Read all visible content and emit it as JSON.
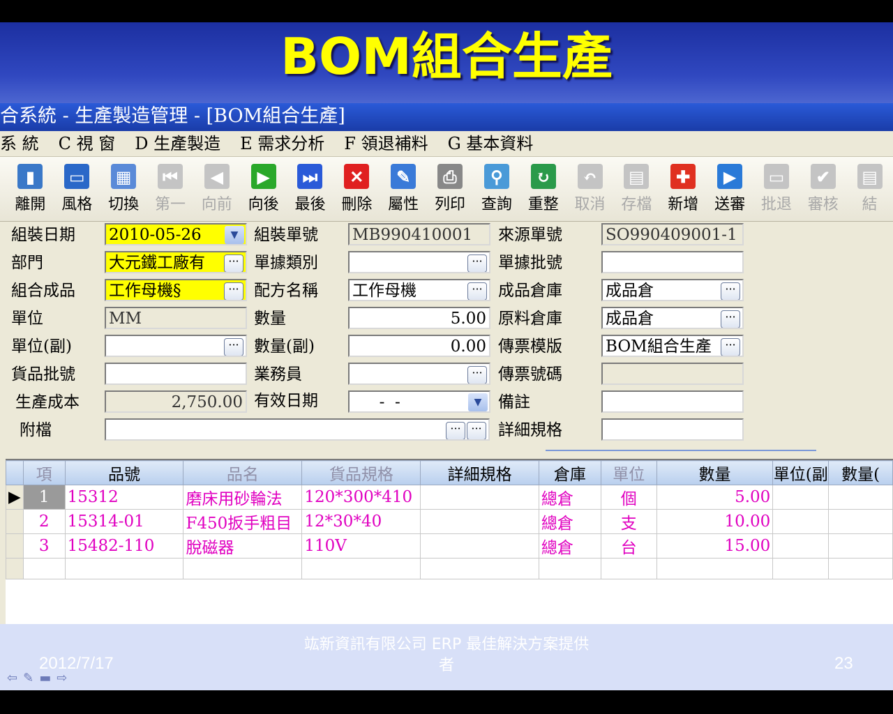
{
  "slide": {
    "title": "BOM組合生產",
    "date": "2012/7/17",
    "company": "竑新資訊有限公司  ERP 最佳解決方案提供者",
    "page": "23"
  },
  "window": {
    "title": "合系統 - 生產製造管理 - [BOM組合生產]"
  },
  "menu": [
    "系 統",
    "C 視 窗",
    "D 生產製造",
    "E 需求分析",
    "F 領退補料",
    "G 基本資料"
  ],
  "toolbar": [
    {
      "label": "離開",
      "icon": "exit-door-icon",
      "color": "#3a78c8",
      "glyph": "▮",
      "enabled": true
    },
    {
      "label": "風格",
      "icon": "window-style-icon",
      "color": "#2a68c8",
      "glyph": "▭",
      "enabled": true
    },
    {
      "label": "切換",
      "icon": "grid-switch-icon",
      "color": "#5a8ad8",
      "glyph": "▦",
      "enabled": true
    },
    {
      "label": "第一",
      "icon": "first-record-icon",
      "color": "#888",
      "glyph": "⏮",
      "enabled": false
    },
    {
      "label": "向前",
      "icon": "previous-record-icon",
      "color": "#888",
      "glyph": "◀",
      "enabled": false
    },
    {
      "label": "向後",
      "icon": "next-record-icon",
      "color": "#2aa82a",
      "glyph": "▶",
      "enabled": true
    },
    {
      "label": "最後",
      "icon": "last-record-icon",
      "color": "#2a5ad8",
      "glyph": "⏭",
      "enabled": true
    },
    {
      "label": "刪除",
      "icon": "delete-x-icon",
      "color": "#e02020",
      "glyph": "✕",
      "enabled": true
    },
    {
      "label": "屬性",
      "icon": "properties-icon",
      "color": "#3a7ad8",
      "glyph": "✎",
      "enabled": true
    },
    {
      "label": "列印",
      "icon": "printer-icon",
      "color": "#888888",
      "glyph": "⎙",
      "enabled": true
    },
    {
      "label": "查詢",
      "icon": "search-magnifier-icon",
      "color": "#4a9ad8",
      "glyph": "⚲",
      "enabled": true
    },
    {
      "label": "重整",
      "icon": "refresh-icon",
      "color": "#2a9a4a",
      "glyph": "↻",
      "enabled": true
    },
    {
      "label": "取消",
      "icon": "undo-cancel-icon",
      "color": "#888",
      "glyph": "↶",
      "enabled": false
    },
    {
      "label": "存檔",
      "icon": "save-disk-icon",
      "color": "#888",
      "glyph": "▤",
      "enabled": false
    },
    {
      "label": "新增",
      "icon": "add-plus-icon",
      "color": "#e03020",
      "glyph": "✚",
      "enabled": true
    },
    {
      "label": "送審",
      "icon": "submit-review-icon",
      "color": "#2a7ad8",
      "glyph": "▶",
      "enabled": true
    },
    {
      "label": "批退",
      "icon": "reject-icon",
      "color": "#888",
      "glyph": "▭",
      "enabled": false
    },
    {
      "label": "審核",
      "icon": "approve-check-icon",
      "color": "#888",
      "glyph": "✔",
      "enabled": false
    },
    {
      "label": "結",
      "icon": "close-case-icon",
      "color": "#888",
      "glyph": "▤",
      "enabled": false
    }
  ],
  "form": {
    "assembly_date_label": "組裝日期",
    "assembly_date": "2010-05-26",
    "assembly_no_label": "組裝單號",
    "assembly_no": "MB990410001",
    "source_no_label": "來源單號",
    "source_no": "SO990409001-1",
    "dept_label": "部門",
    "dept": "大元鐵工廠有",
    "doc_type_label": "單據類別",
    "doc_type": "",
    "doc_batch_label": "單據批號",
    "doc_batch": "",
    "product_label": "組合成品",
    "product": "工作母機§",
    "recipe_label": "配方名稱",
    "recipe": "工作母機",
    "fg_wh_label": "成品倉庫",
    "fg_wh": "成品倉",
    "unit_label": "單位",
    "unit": "MM",
    "qty_label": "數量",
    "qty": "5.00",
    "raw_wh_label": "原料倉庫",
    "raw_wh": "成品倉",
    "unit2_label": "單位(副)",
    "unit2": "",
    "qty2_label": "數量(副)",
    "qty2": "0.00",
    "voucher_tpl_label": "傳票模版",
    "voucher_tpl": "BOM組合生產",
    "lot_label": "貨品批號",
    "lot": "",
    "sales_label": "業務員",
    "sales": "",
    "voucher_no_label": "傳票號碼",
    "voucher_no": "",
    "cost_label": "生產成本",
    "cost": "2,750.00",
    "expiry_label": "有效日期",
    "expiry": "  -  -",
    "remark_label": "備註",
    "remark": "",
    "attach_label": "附檔",
    "attach": "",
    "spec_label": "詳細規格",
    "spec": ""
  },
  "grid": {
    "headers": [
      "項",
      "品號",
      "品名",
      "貨品規格",
      "詳細規格",
      "倉庫",
      "單位",
      "數量",
      "單位(副",
      "數量("
    ],
    "rows": [
      [
        "1",
        "15312",
        "磨床用砂輪法",
        "120*300*410",
        "",
        "總倉",
        "個",
        "5.00",
        "",
        ""
      ],
      [
        "2",
        "15314-01",
        "F450扳手粗目",
        "12*30*40",
        "",
        "總倉",
        "支",
        "10.00",
        "",
        ""
      ],
      [
        "3",
        "15482-110",
        "脫磁器",
        "110V",
        "",
        "總倉",
        "台",
        "15.00",
        "",
        ""
      ]
    ]
  }
}
